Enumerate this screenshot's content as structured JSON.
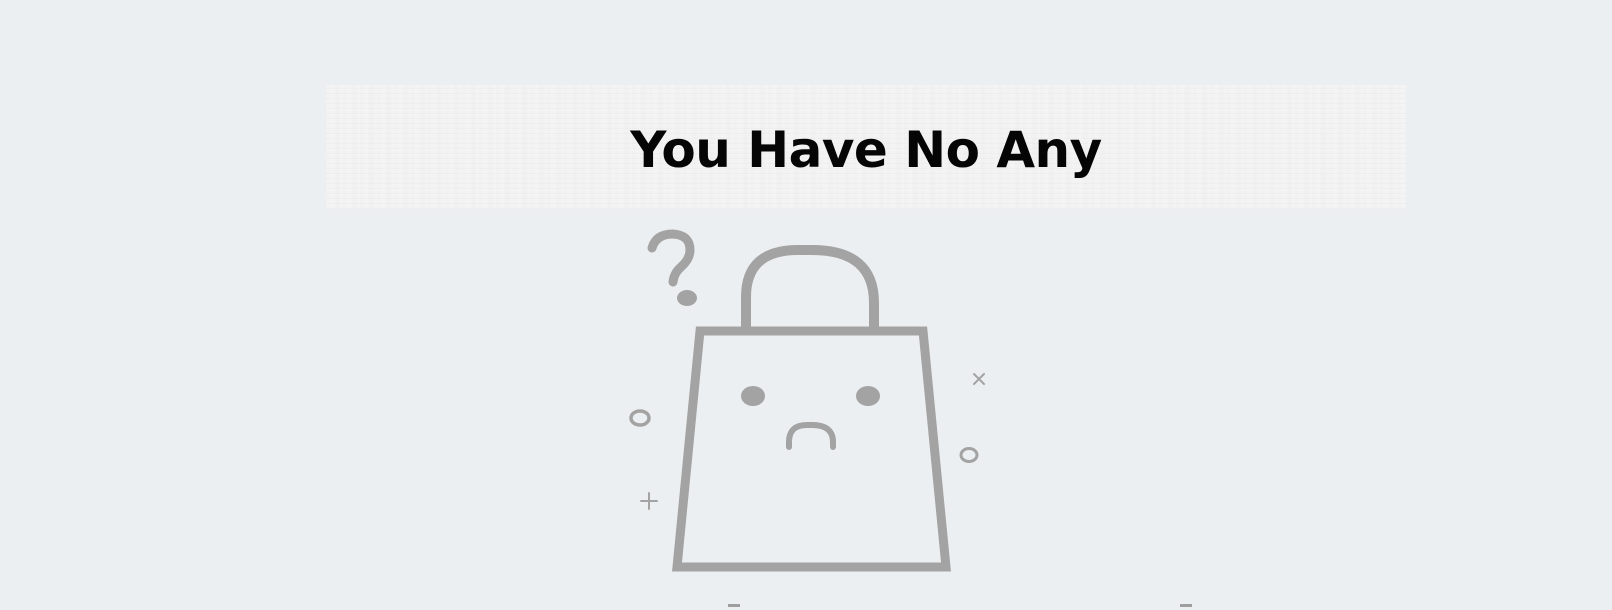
{
  "empty_state": {
    "title": "You Have No Any",
    "illustration_icon": "sad-shopping-bag-icon",
    "decoration_icons": [
      "question-mark-icon",
      "circle-icon",
      "plus-icon",
      "cross-icon"
    ]
  },
  "colors": {
    "background": "#eceff1",
    "banner": "#f6f6f6",
    "title": "#050505",
    "illustration_stroke": "#a3a3a3"
  }
}
